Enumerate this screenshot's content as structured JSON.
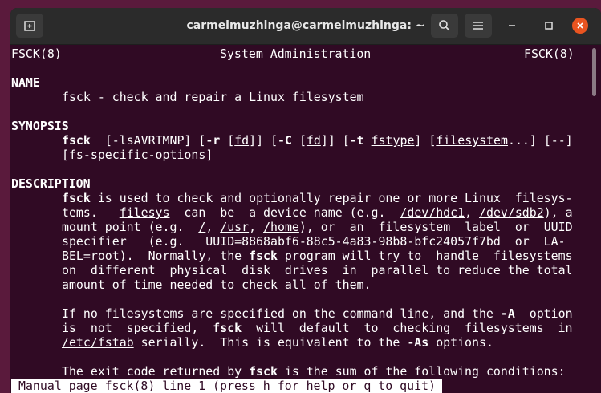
{
  "window": {
    "title": "carmelmuzhinga@carmelmuzhinga: ~",
    "icons": [
      "new-tab-icon",
      "search-icon",
      "hamburger-menu-icon",
      "minimize-icon",
      "maximize-icon",
      "close-icon"
    ],
    "close_color": "#e95420",
    "terminal_bg": "#300a24"
  },
  "man": {
    "header_left": "FSCK(8)",
    "header_center": "System Administration",
    "header_right": "FSCK(8)",
    "name_heading": "NAME",
    "name_line": "fsck - check and repair a Linux filesystem",
    "synopsis_heading": "SYNOPSIS",
    "synopsis": {
      "cmd": "fsck",
      "opt1": "[-lsAVRTMNP]",
      "r_open": "[",
      "r_flag": "-r",
      "r_arg": "fd",
      "r_close": "]",
      "c_open": "[",
      "c_flag": "-C",
      "c_arg": "fd",
      "c_close": "]",
      "t_open": "[",
      "t_flag": "-t",
      "t_arg": "fstype",
      "t_close": "]",
      "fs_open": "[",
      "fs_arg": "filesystem",
      "fs_close": "...]",
      "dashdash": "[--]",
      "fsso_open": "[",
      "fsso_arg": "fs-specific-options",
      "fsso_close": "]"
    },
    "description_heading": "DESCRIPTION",
    "desc": {
      "l1_cmd": "fsck",
      "l1_rest": " is used to check and optionally repair one or more Linux  filesys-",
      "l2_a": "tems.   ",
      "l2_filesys": "filesys",
      "l2_b": "  can  be  a device name (e.g.  ",
      "l2_dev1": "/dev/hdc1",
      "l2_c": ", ",
      "l2_dev2": "/dev/sdb2",
      "l2_d": "), a",
      "l3_a": "mount point (e.g.  ",
      "l3_root": "/",
      "l3_b": ", ",
      "l3_usr": "/usr",
      "l3_c": ", ",
      "l3_home": "/home",
      "l3_d": "), or  an  filesystem  label  or  UUID",
      "l4": "specifier   (e.g.   UUID=8868abf6-88c5-4a83-98b8-bfc24057f7bd  or  LA-",
      "l5_a": "BEL=root).  Normally, the ",
      "l5_cmd": "fsck",
      "l5_b": " program will try to  handle  filesystems",
      "l6": "on  different  physical  disk  drives  in  parallel to reduce the total",
      "l7": "amount of time needed to check all of them.",
      "p2_l1_a": "If no filesystems are specified on the command line, and the ",
      "p2_l1_flag": "-A",
      "p2_l1_b": "  option",
      "p2_l2_a": "is  not  specified,  ",
      "p2_l2_cmd": "fsck",
      "p2_l2_b": "  will  default  to  checking  filesystems  in",
      "p2_l3_path": "/etc/fstab",
      "p2_l3_a": " serially.  This is equivalent to the ",
      "p2_l3_flag": "-As",
      "p2_l3_b": " options.",
      "p3_l1_a": "The exit code returned by ",
      "p3_l1_cmd": "fsck",
      "p3_l1_b": " is the sum of the following conditions:"
    },
    "status_line": "Manual page fsck(8) line 1 (press h for help or q to quit)"
  }
}
